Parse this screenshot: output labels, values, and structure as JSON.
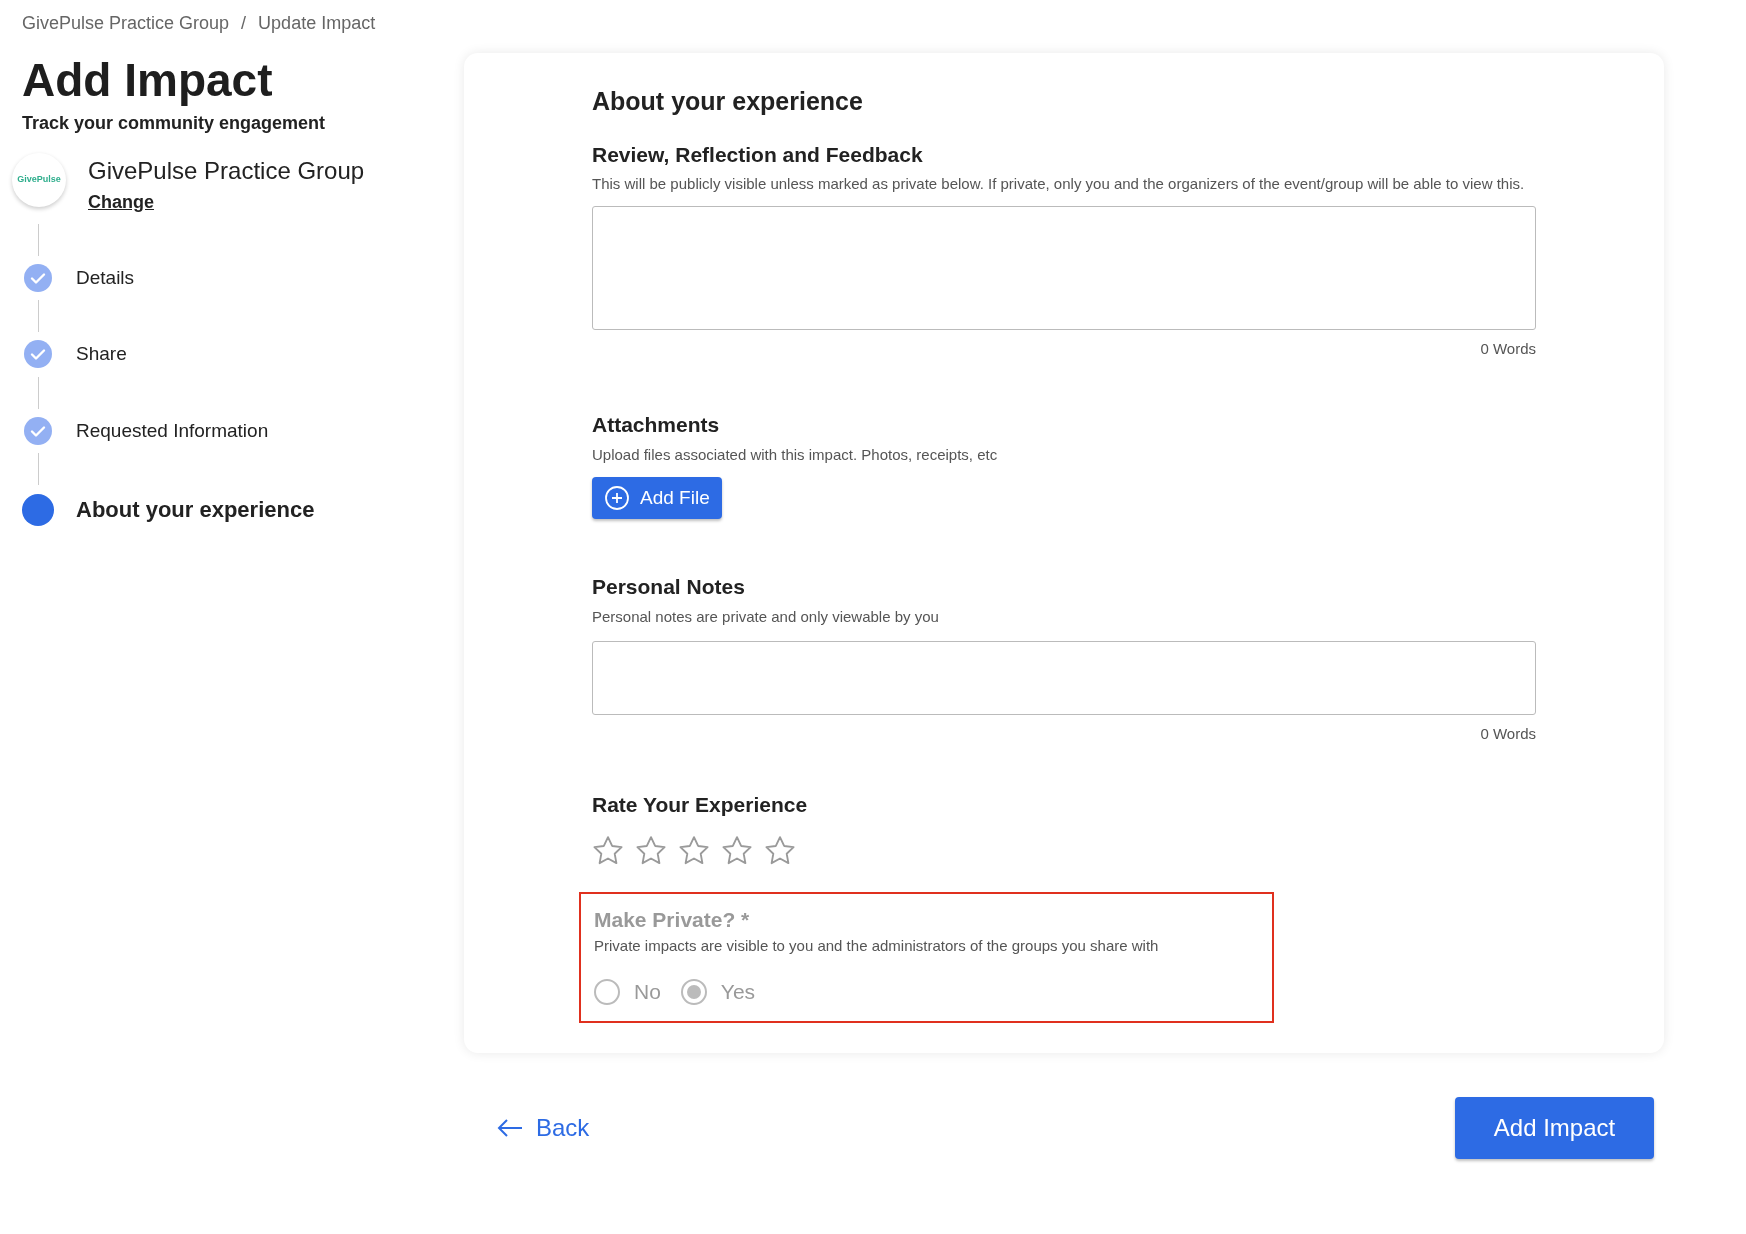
{
  "breadcrumb": [
    "GivePulse Practice Group",
    "Update Impact"
  ],
  "breadcrumb_separator": "/",
  "page": {
    "title": "Add Impact",
    "subtitle": "Track your community engagement"
  },
  "group": {
    "logo_text": "GivePulse",
    "name": "GivePulse Practice Group",
    "change_link": "Change"
  },
  "steps": [
    {
      "label": "Details",
      "completed": true,
      "selected": false
    },
    {
      "label": "Share",
      "completed": true,
      "selected": false
    },
    {
      "label": "Requested Information",
      "completed": true,
      "selected": false
    },
    {
      "label": "About your experience",
      "completed": false,
      "selected": true
    }
  ],
  "form": {
    "title": "About your experience",
    "review": {
      "label": "Review, Reflection and Feedback",
      "help": "This will be publicly visible unless marked as private below. If private, only you and the organizers of the event/group will be able to view this.",
      "word_count": "0 Words"
    },
    "attachments": {
      "label": "Attachments",
      "help": "Upload files associated with this impact. Photos, receipts, etc",
      "button": "Add File"
    },
    "notes": {
      "label": "Personal Notes",
      "help": "Personal notes are private and only viewable by you",
      "word_count": "0 Words"
    },
    "rating": {
      "label": "Rate Your Experience",
      "stars": 0
    },
    "make_private": {
      "label": "Make Private? *",
      "help": "Private impacts are visible to you and the administrators of the groups you share with",
      "disabled": true,
      "highlighted": true,
      "options": [
        {
          "label": "No",
          "selected": false
        },
        {
          "label": "Yes",
          "selected": true
        }
      ]
    }
  },
  "footer": {
    "back": "Back",
    "submit": "Add Impact"
  }
}
